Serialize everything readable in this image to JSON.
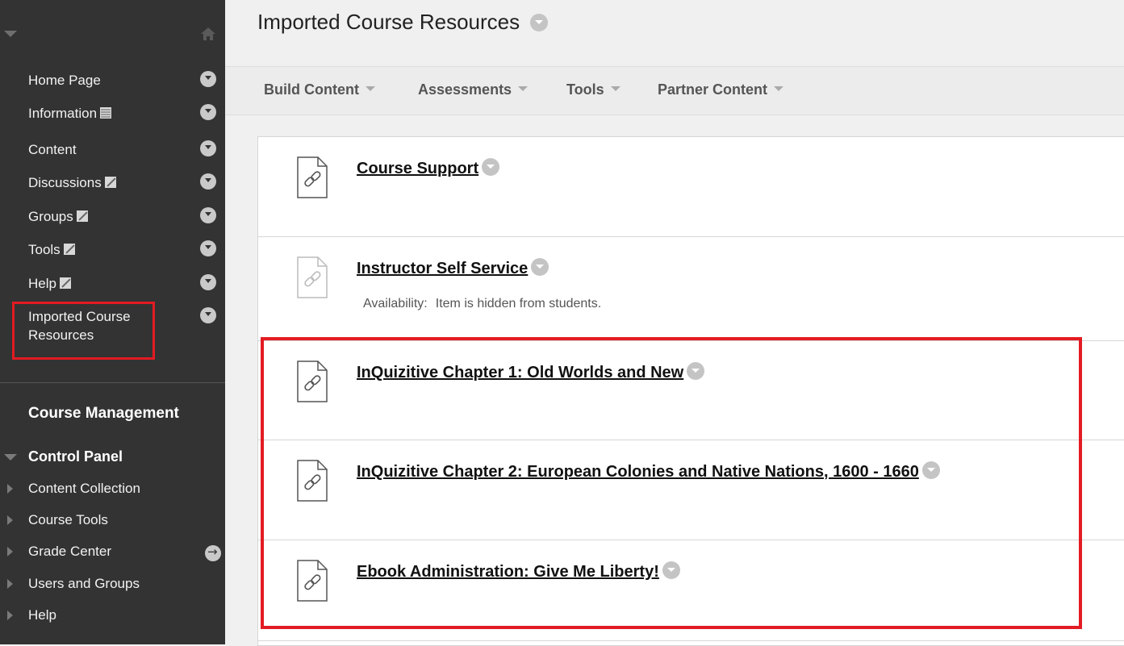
{
  "sidebar": {
    "items": [
      {
        "label": "Home Page",
        "icon": ""
      },
      {
        "label": "Information",
        "icon": "grid"
      },
      {
        "label": "Content",
        "icon": ""
      },
      {
        "label": "Discussions",
        "icon": "slash"
      },
      {
        "label": "Groups",
        "icon": "slash"
      },
      {
        "label": "Tools",
        "icon": "slash"
      },
      {
        "label": "Help",
        "icon": "slash"
      },
      {
        "label": "Imported Course Resources",
        "icon": ""
      }
    ],
    "course_management": "Course Management",
    "control_panel": "Control Panel",
    "control_items": [
      "Content Collection",
      "Course Tools",
      "Grade Center",
      "Users and Groups",
      "Help"
    ]
  },
  "main": {
    "title": "Imported Course Resources",
    "toolbar": [
      "Build Content",
      "Assessments",
      "Tools",
      "Partner Content"
    ],
    "items": [
      {
        "title": "Course Support",
        "hidden": false
      },
      {
        "title": "Instructor Self Service",
        "hidden": true,
        "availability_label": "Availability:",
        "availability_value": "Item is hidden from students."
      },
      {
        "title": "InQuizitive Chapter 1: Old Worlds and New",
        "hidden": false
      },
      {
        "title": "InQuizitive Chapter 2: European Colonies and Native Nations, 1600 - 1660",
        "hidden": false
      },
      {
        "title": "Ebook Administration: Give Me Liberty!",
        "hidden": false
      }
    ]
  },
  "colors": {
    "sidebar_bg": "#333333",
    "highlight": "#e31b23"
  }
}
